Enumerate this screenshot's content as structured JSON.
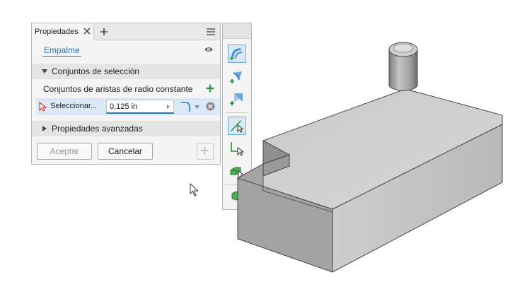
{
  "panel": {
    "tab_label": "Propiedades",
    "feature_name": "Empalme",
    "section_selection": "Conjuntos de selección",
    "edge_sets_label": "Conjuntos de aristas de radio constante",
    "select_label": "Seleccionar...",
    "radius_value": "0,125 in",
    "section_advanced": "Propiedades avanzadas",
    "ok_label": "Aceptar",
    "cancel_label": "Cancelar"
  },
  "toolbar": {
    "tools": [
      "constant-radius-fillet",
      "variable-radius-fillet",
      "setback-fillet",
      "edge-select-mode",
      "loop-select-mode",
      "feature-select-mode",
      "all-edges-mode"
    ]
  },
  "colors": {
    "accent": "#1f7ac4",
    "add_green": "#2ea043",
    "selection_bg": "#dbe9f7"
  }
}
